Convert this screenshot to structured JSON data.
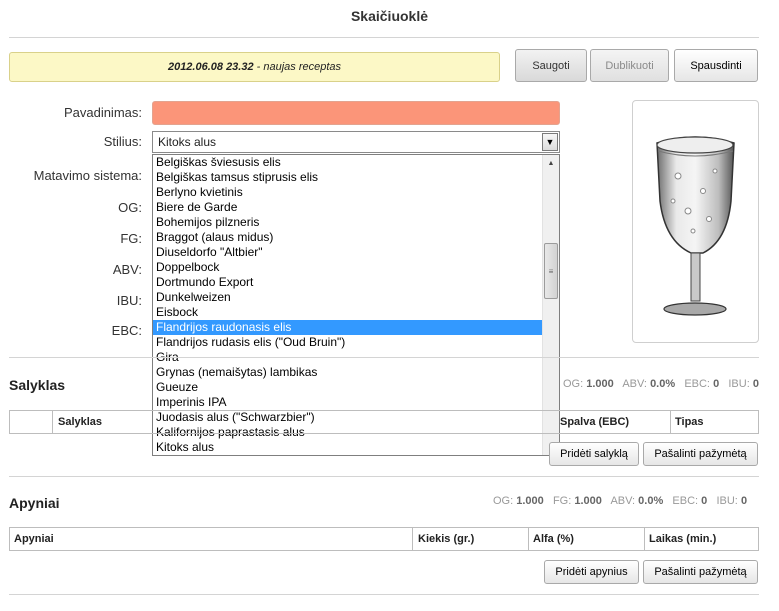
{
  "page": {
    "title": "Skaičiuoklė"
  },
  "notice": {
    "date": "2012.06.08 23.32",
    "text": " - naujas receptas"
  },
  "toolbar": {
    "save_label": "Saugoti",
    "duplicate_label": "Dublikuoti",
    "print_label": "Spausdinti"
  },
  "form": {
    "name_label": "Pavadinimas:",
    "name_value": "",
    "style_label": "Stilius:",
    "style_value": "Kitoks alus",
    "measure_label": "Matavimo sistema:",
    "og_label": "OG:",
    "fg_label": "FG:",
    "abv_label": "ABV:",
    "ibu_label": "IBU:",
    "ebc_label": "EBC:"
  },
  "dropdown": {
    "options": [
      "Belgiškas šviesusis elis",
      "Belgiškas tamsus stiprusis elis",
      "Berlyno kvietinis",
      "Biere de Garde",
      "Bohemijos pilzneris",
      "Braggot (alaus midus)",
      "Diuseldorfo \"Altbier\"",
      "Doppelbock",
      "Dortmundo Export",
      "Dunkelweizen",
      "Eisbock",
      "Flandrijos raudonasis elis",
      "Flandrijos rudasis elis (\"Oud Bruin\")",
      "Gira",
      "Grynas (nemaišytas) lambikas",
      "Gueuze",
      "Imperinis IPA",
      "Juodasis alus (\"Schwarzbier\")",
      "Kalifornijos paprastasis alus",
      "Kitoks alus"
    ],
    "selected_index": 11
  },
  "malt": {
    "title": "Salyklas",
    "stats": {
      "og_label": "OG:",
      "og": "1.000",
      "abv_label": "ABV:",
      "abv": "0.0%",
      "ebc_label": "EBC:",
      "ebc": "0",
      "ibu_label": "IBU:",
      "ibu": "0"
    },
    "columns": [
      "Salyklas",
      "Spalva (EBC)",
      "Tipas"
    ],
    "add_label": "Pridėti salyklą",
    "remove_label": "Pašalinti pažymėtą"
  },
  "hops": {
    "title": "Apyniai",
    "stats": {
      "og_label": "OG:",
      "og": "1.000",
      "fg_label": "FG:",
      "fg": "1.000",
      "abv_label": "ABV:",
      "abv": "0.0%",
      "ebc_label": "EBC:",
      "ebc": "0",
      "ibu_label": "IBU:",
      "ibu": "0"
    },
    "columns": [
      "Apyniai",
      "Kiekis (gr.)",
      "Alfa (%)",
      "Laikas (min.)"
    ],
    "add_label": "Pridėti apynius",
    "remove_label": "Pašalinti pažymėtą"
  },
  "colors": {
    "notice_bg": "#fcf8c6",
    "name_input_bg": "#fb9579",
    "selected_option": "#3399ff"
  }
}
